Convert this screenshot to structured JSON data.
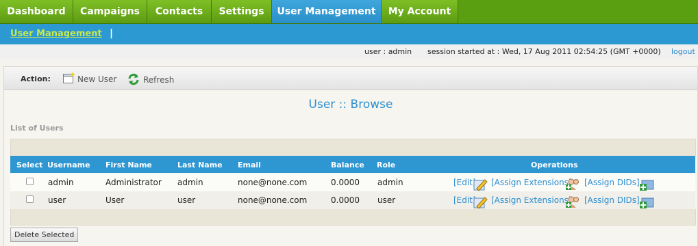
{
  "nav": {
    "tabs": [
      "Dashboard",
      "Campaigns",
      "Contacts",
      "Settings",
      "User Management",
      "My Account"
    ],
    "active": "User Management"
  },
  "subnav": {
    "link": "User Management",
    "separator": "|"
  },
  "session": {
    "user": "user : admin",
    "started": "session started at : Wed, 17 Aug 2011 02:54:25 (GMT +0000)",
    "logout": "logout"
  },
  "actions": {
    "label": "Action:",
    "new_user": "New User",
    "refresh": "Refresh"
  },
  "page": {
    "title": "User :: Browse",
    "list_title": "List of Users"
  },
  "table": {
    "headers": [
      "Select",
      "Username",
      "First Name",
      "Last Name",
      "Email",
      "Balance",
      "Role",
      "Operations"
    ],
    "rows": [
      {
        "username": "admin",
        "first_name": "Administrator",
        "last_name": "admin",
        "email": "none@none.com",
        "balance": "0.0000",
        "role": "admin"
      },
      {
        "username": "user",
        "first_name": "User",
        "last_name": "user",
        "email": "none@none.com",
        "balance": "0.0000",
        "role": "user"
      }
    ],
    "operations": {
      "edit": "[Edit]",
      "assign_extensions": "[Assign Extensions]",
      "assign_dids": "[Assign DIDs]"
    }
  },
  "delete_button": "Delete Selected",
  "icons": {
    "new_user": "new-document-icon",
    "refresh": "refresh-arrows-icon",
    "edit": "edit-pencil-icon",
    "extensions": "add-users-icon",
    "dids": "add-folder-icon"
  },
  "colors": {
    "nav_green": "#5a9e11",
    "active_blue": "#2d99d2",
    "link_blue": "#2e8fd0",
    "sublink_green": "#c9e84a"
  }
}
